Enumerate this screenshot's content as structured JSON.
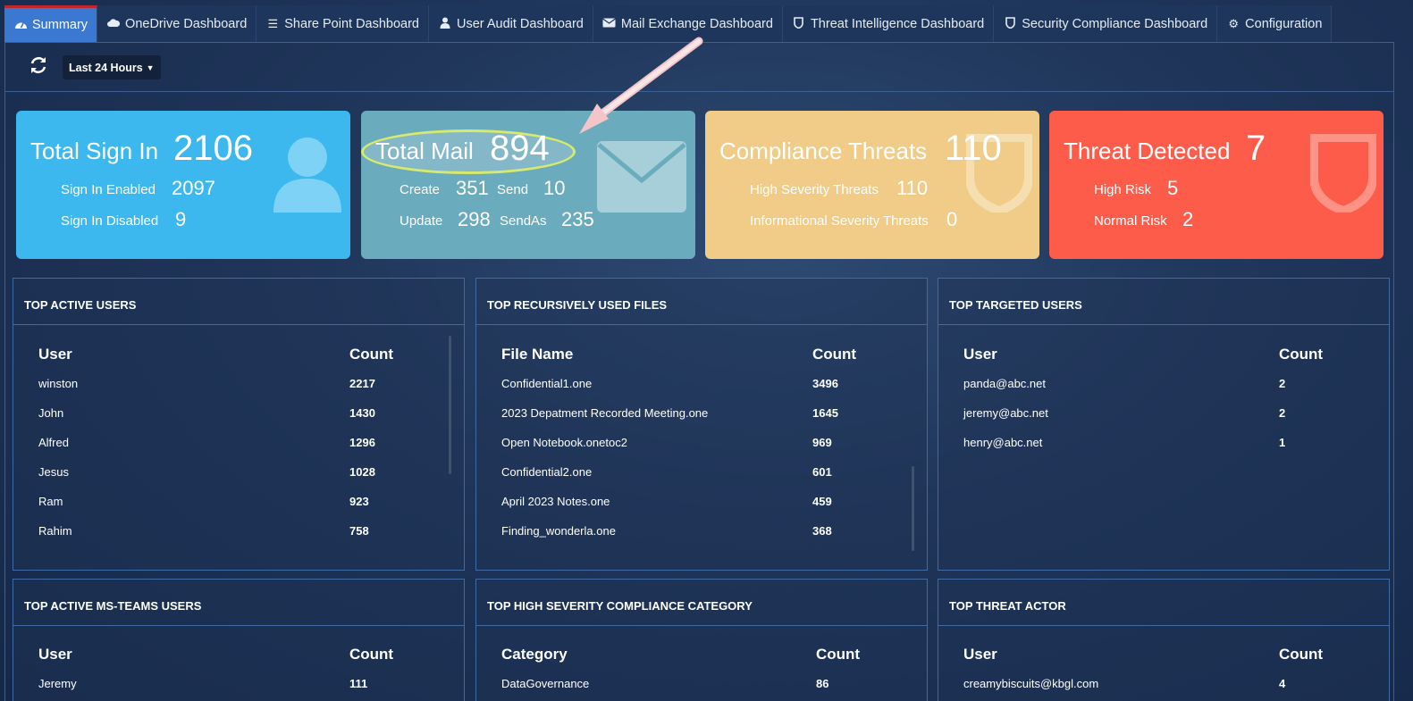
{
  "nav": {
    "tabs": [
      {
        "label": "Summary",
        "icon": "dashboard-icon",
        "active": true
      },
      {
        "label": "OneDrive Dashboard",
        "icon": "cloud-icon"
      },
      {
        "label": "Share Point Dashboard",
        "icon": "list-icon"
      },
      {
        "label": "User Audit Dashboard",
        "icon": "user-icon"
      },
      {
        "label": "Mail Exchange Dashboard",
        "icon": "envelope-icon"
      },
      {
        "label": "Threat Intelligence Dashboard",
        "icon": "shield-icon"
      },
      {
        "label": "Security Compliance Dashboard",
        "icon": "shield-icon"
      },
      {
        "label": "Configuration",
        "icon": "gear-icon"
      }
    ]
  },
  "toolbar": {
    "time_range": "Last 24 Hours"
  },
  "cards": {
    "signin": {
      "title": "Total Sign In",
      "value": "2106",
      "rows": [
        {
          "label": "Sign In Enabled",
          "value": "2097"
        },
        {
          "label": "Sign In Disabled",
          "value": "9"
        }
      ]
    },
    "mail": {
      "title": "Total Mail",
      "value": "894",
      "create_label": "Create",
      "create": "351",
      "send_label": "Send",
      "send": "10",
      "update_label": "Update",
      "update": "298",
      "sendas_label": "SendAs",
      "sendas": "235"
    },
    "compliance": {
      "title": "Compliance Threats",
      "value": "110",
      "rows": [
        {
          "label": "High Severity Threats",
          "value": "110"
        },
        {
          "label": "Informational Severity Threats",
          "value": "0"
        }
      ]
    },
    "threat": {
      "title": "Threat Detected",
      "value": "7",
      "rows": [
        {
          "label": "High Risk",
          "value": "5"
        },
        {
          "label": "Normal Risk",
          "value": "2"
        }
      ]
    }
  },
  "colors": {
    "signin": "#3db8ee",
    "mail": "#6aabbd",
    "compliance": "#f0cc88",
    "threat": "#fd5c4a",
    "active_tab": "#3a78d2"
  },
  "panels": {
    "active_users": {
      "title": "TOP ACTIVE USERS",
      "col1": "User",
      "col2": "Count",
      "rows": [
        [
          "winston",
          "2217"
        ],
        [
          "John",
          "1430"
        ],
        [
          "Alfred",
          "1296"
        ],
        [
          "Jesus",
          "1028"
        ],
        [
          "Ram",
          "923"
        ],
        [
          "Rahim",
          "758"
        ]
      ]
    },
    "files": {
      "title": "TOP RECURSIVELY USED FILES",
      "col1": "File Name",
      "col2": "Count",
      "rows": [
        [
          "Confidential1.one",
          "3496"
        ],
        [
          "2023 Depatment Recorded Meeting.one",
          "1645"
        ],
        [
          "Open Notebook.onetoc2",
          "969"
        ],
        [
          "Confidential2.one",
          "601"
        ],
        [
          "April 2023 Notes.one",
          "459"
        ],
        [
          "Finding_wonderla.one",
          "368"
        ]
      ]
    },
    "targeted": {
      "title": "TOP TARGETED USERS",
      "col1": "User",
      "col2": "Count",
      "rows": [
        [
          "panda@abc.net",
          "2"
        ],
        [
          "jeremy@abc.net",
          "2"
        ],
        [
          "henry@abc.net",
          "1"
        ]
      ]
    },
    "teams": {
      "title": "TOP ACTIVE MS-TEAMS USERS",
      "col1": "User",
      "col2": "Count",
      "rows": [
        [
          "Jeremy",
          "111"
        ]
      ]
    },
    "category": {
      "title": "TOP HIGH SEVERITY COMPLIANCE CATEGORY",
      "col1": "Category",
      "col2": "Count",
      "rows": [
        [
          "DataGovernance",
          "86"
        ]
      ]
    },
    "actor": {
      "title": "TOP THREAT ACTOR",
      "col1": "User",
      "col2": "Count",
      "rows": [
        [
          "creamybiscuits@kbgl.com",
          "4"
        ]
      ]
    }
  }
}
